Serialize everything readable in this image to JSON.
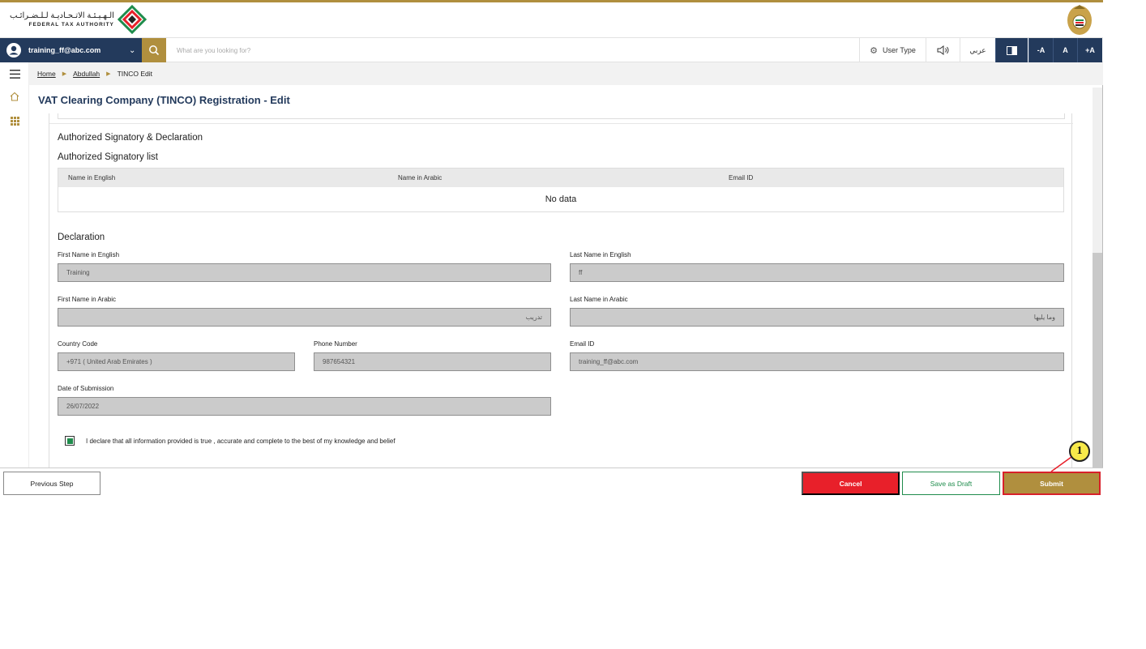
{
  "header": {
    "logo_arabic": "الـهـيـئـة الاتـحـاديـة لـلـضـرائـب",
    "logo_english": "FEDERAL TAX AUTHORITY"
  },
  "topbar": {
    "user_email": "training_ff@abc.com",
    "search_placeholder": "What are you looking for?",
    "user_type_label": "User Type",
    "arabic_toggle": "عربي",
    "font_decrease": "-A",
    "font_normal": "A",
    "font_increase": "+A"
  },
  "breadcrumb": {
    "home": "Home",
    "parent": "Abdullah",
    "current": "TINCO Edit"
  },
  "page_title": "VAT Clearing Company (TINCO) Registration - Edit",
  "signatory": {
    "section_title": "Authorized Signatory & Declaration",
    "list_title": "Authorized Signatory list",
    "columns": [
      "Name in English",
      "Name in Arabic",
      "Email ID"
    ],
    "empty_text": "No data"
  },
  "declaration": {
    "title": "Declaration",
    "first_name_en_label": "First Name in English",
    "first_name_en": "Training",
    "last_name_en_label": "Last Name in English",
    "last_name_en": "ff",
    "first_name_ar_label": "First Name in Arabic",
    "first_name_ar": "تدريب",
    "last_name_ar_label": "Last Name in Arabic",
    "last_name_ar": "وما يليها",
    "country_code_label": "Country Code",
    "country_code": "+971 ( United Arab Emirates )",
    "phone_label": "Phone Number",
    "phone": "987654321",
    "email_label": "Email ID",
    "email": "training_ff@abc.com",
    "date_label": "Date of Submission",
    "date": "26/07/2022",
    "checkbox_text": "I declare that all information provided is true , accurate and complete to the best of my knowledge and belief"
  },
  "footer": {
    "previous": "Previous Step",
    "cancel": "Cancel",
    "save_draft": "Save as Draft",
    "submit": "Submit"
  },
  "callout_number": "1",
  "colors": {
    "navy": "#233a5c",
    "gold": "#b08f3e",
    "red": "#e8202a",
    "green": "#1f8c4c"
  }
}
